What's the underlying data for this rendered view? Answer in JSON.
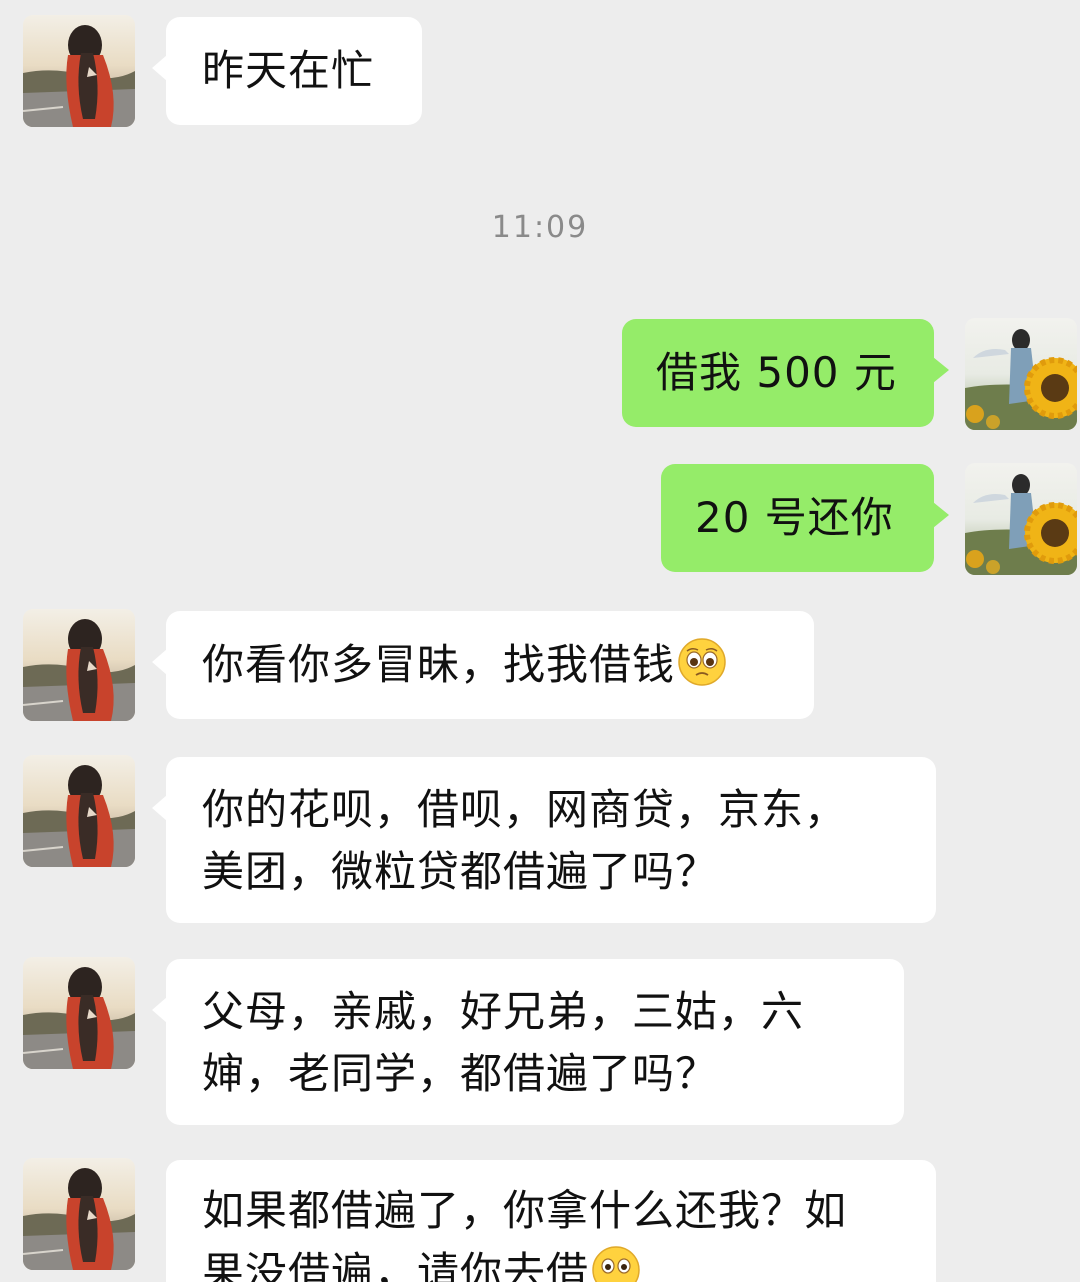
{
  "chat": {
    "timestamp": "11:09",
    "messages": [
      {
        "sender": "contact",
        "text": "昨天在忙"
      },
      {
        "sender": "me",
        "text": "借我 500 元"
      },
      {
        "sender": "me",
        "text": "20 号还你"
      },
      {
        "sender": "contact",
        "text": "你看你多冒昧，找我借钱",
        "emoji": "pleading-face-emoji"
      },
      {
        "sender": "contact",
        "text": "你的花呗，借呗，网商贷，京东，\n美团，微粒贷都借遍了吗？"
      },
      {
        "sender": "contact",
        "text": "父母，亲戚，好兄弟，三姑，六\n婶，老同学，都借遍了吗？"
      },
      {
        "sender": "contact",
        "text": "如果都借遍了，你拿什么还我？如\n果没借遍，请你去借",
        "emoji": "flushed-face-emoji"
      }
    ]
  },
  "colors": {
    "background": "#ededed",
    "incoming_bubble": "#ffffff",
    "outgoing_bubble": "#95ec69",
    "timestamp_text": "#8a8a8a"
  },
  "icons": {
    "contact_avatar": "contact-avatar-girl-road",
    "my_avatar": "my-avatar-sunflower"
  }
}
